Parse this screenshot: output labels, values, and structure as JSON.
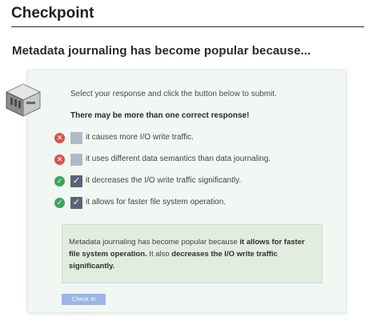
{
  "header": {
    "title": "Checkpoint"
  },
  "question": {
    "text": "Metadata journaling has become popular because..."
  },
  "card": {
    "instruction": "Select your response and click the button below to submit.",
    "multi_note": "There may be more than one correct response!",
    "options": [
      {
        "label": "it causes more I/O write traffic.",
        "checked": false,
        "status": "incorrect",
        "status_icon": "x-circle-icon"
      },
      {
        "label": "it uses different data semantics than data journaling.",
        "checked": false,
        "status": "incorrect",
        "status_icon": "x-circle-icon"
      },
      {
        "label": "it decreases the I/O write traffic significantly.",
        "checked": true,
        "status": "correct",
        "status_icon": "check-circle-icon"
      },
      {
        "label": "it allows for faster file system operation.",
        "checked": true,
        "status": "correct",
        "status_icon": "check-circle-icon"
      }
    ],
    "feedback": {
      "part1": "Metadata journaling has become popular because ",
      "bold1": "it allows for faster file system operation.",
      "part2": " It also ",
      "bold2": "decreases the I/O write traffic significantly."
    },
    "submit_label": "Check It!"
  },
  "colors": {
    "card_bg": "#f1f7f3",
    "feedback_bg": "#e2ecdf",
    "correct": "#3ea55a",
    "incorrect": "#d9534f",
    "checkbox_checked": "#5d6377",
    "checkbox_unchecked": "#b4b8c5",
    "button": "#9bb5e6"
  }
}
